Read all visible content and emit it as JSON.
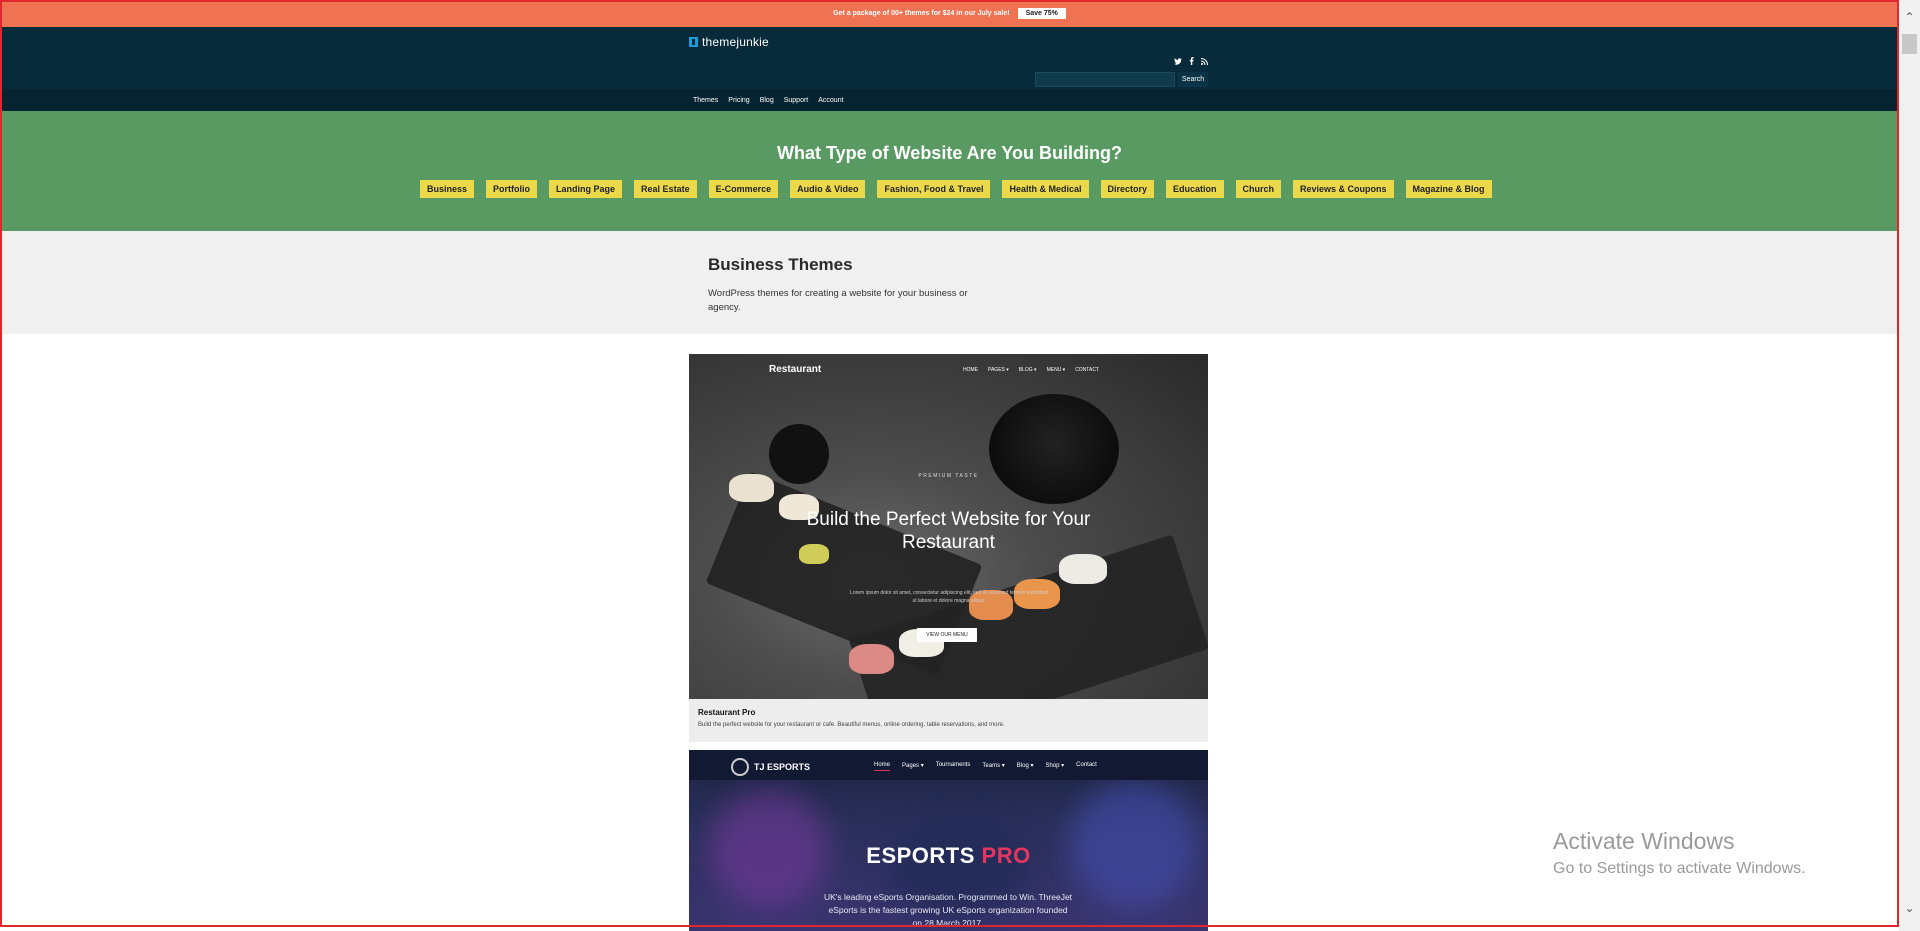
{
  "promo": {
    "text": "Get a package of 00+ themes for $24 in our July sale!",
    "button": "Save 75%"
  },
  "header": {
    "logo_text": "themejunkie",
    "social_icons": [
      "twitter-icon",
      "facebook-icon",
      "rss-icon"
    ],
    "search_button": "Search",
    "search_placeholder": ""
  },
  "nav": {
    "items": [
      "Themes",
      "Pricing",
      "Blog",
      "Support",
      "Account"
    ]
  },
  "hero": {
    "title": "What Type of Website Are You Building?",
    "categories": [
      "Business",
      "Portfolio",
      "Landing Page",
      "Real Estate",
      "E-Commerce",
      "Audio & Video",
      "Fashion, Food & Travel",
      "Health & Medical",
      "Directory",
      "Education",
      "Church",
      "Reviews & Coupons",
      "Magazine & Blog"
    ]
  },
  "intro": {
    "title": "Business Themes",
    "description": "WordPress themes for creating a website for your business or agency."
  },
  "themes": [
    {
      "name": "Restaurant Pro",
      "description": "Build the perfect website for your restaurant or cafe. Beautiful menus, online ordering, table reservations, and more.",
      "preview": {
        "logo": "Restaurant",
        "menu": [
          "HOME",
          "PAGES ▾",
          "BLOG ▾",
          "MENU ▾",
          "CONTACT"
        ],
        "tagline": "PREMIUM TASTE",
        "headline": "Build the Perfect Website for Your Restaurant",
        "body": "Lorem ipsum dolor sit amet, consectetur adipiscing elit, sed do eiusmod tempor incididunt ut labore et dolore magna aliqua.",
        "button": "VIEW OUR MENU"
      }
    },
    {
      "name": "Esports Pro",
      "preview": {
        "logo": "TJ ESPORTS",
        "menu": [
          "Home",
          "Pages ▾",
          "Tournaments",
          "Teams ▾",
          "Blog ▾",
          "Shop ▾",
          "Contact"
        ],
        "headline_main": "ESPORTS",
        "headline_accent": "PRO",
        "body": "UK's leading eSports Organisation. Programmed to Win. ThreeJet eSports is the fastest growing UK eSports organization founded on 28 March 2017."
      }
    }
  ],
  "watermark": {
    "line1": "Activate Windows",
    "line2": "Go to Settings to activate Windows."
  },
  "colors": {
    "promo": "#ef7353",
    "header": "#072b3a",
    "hero": "#589a62",
    "category": "#ecd94a",
    "esports_accent": "#e3365f"
  }
}
